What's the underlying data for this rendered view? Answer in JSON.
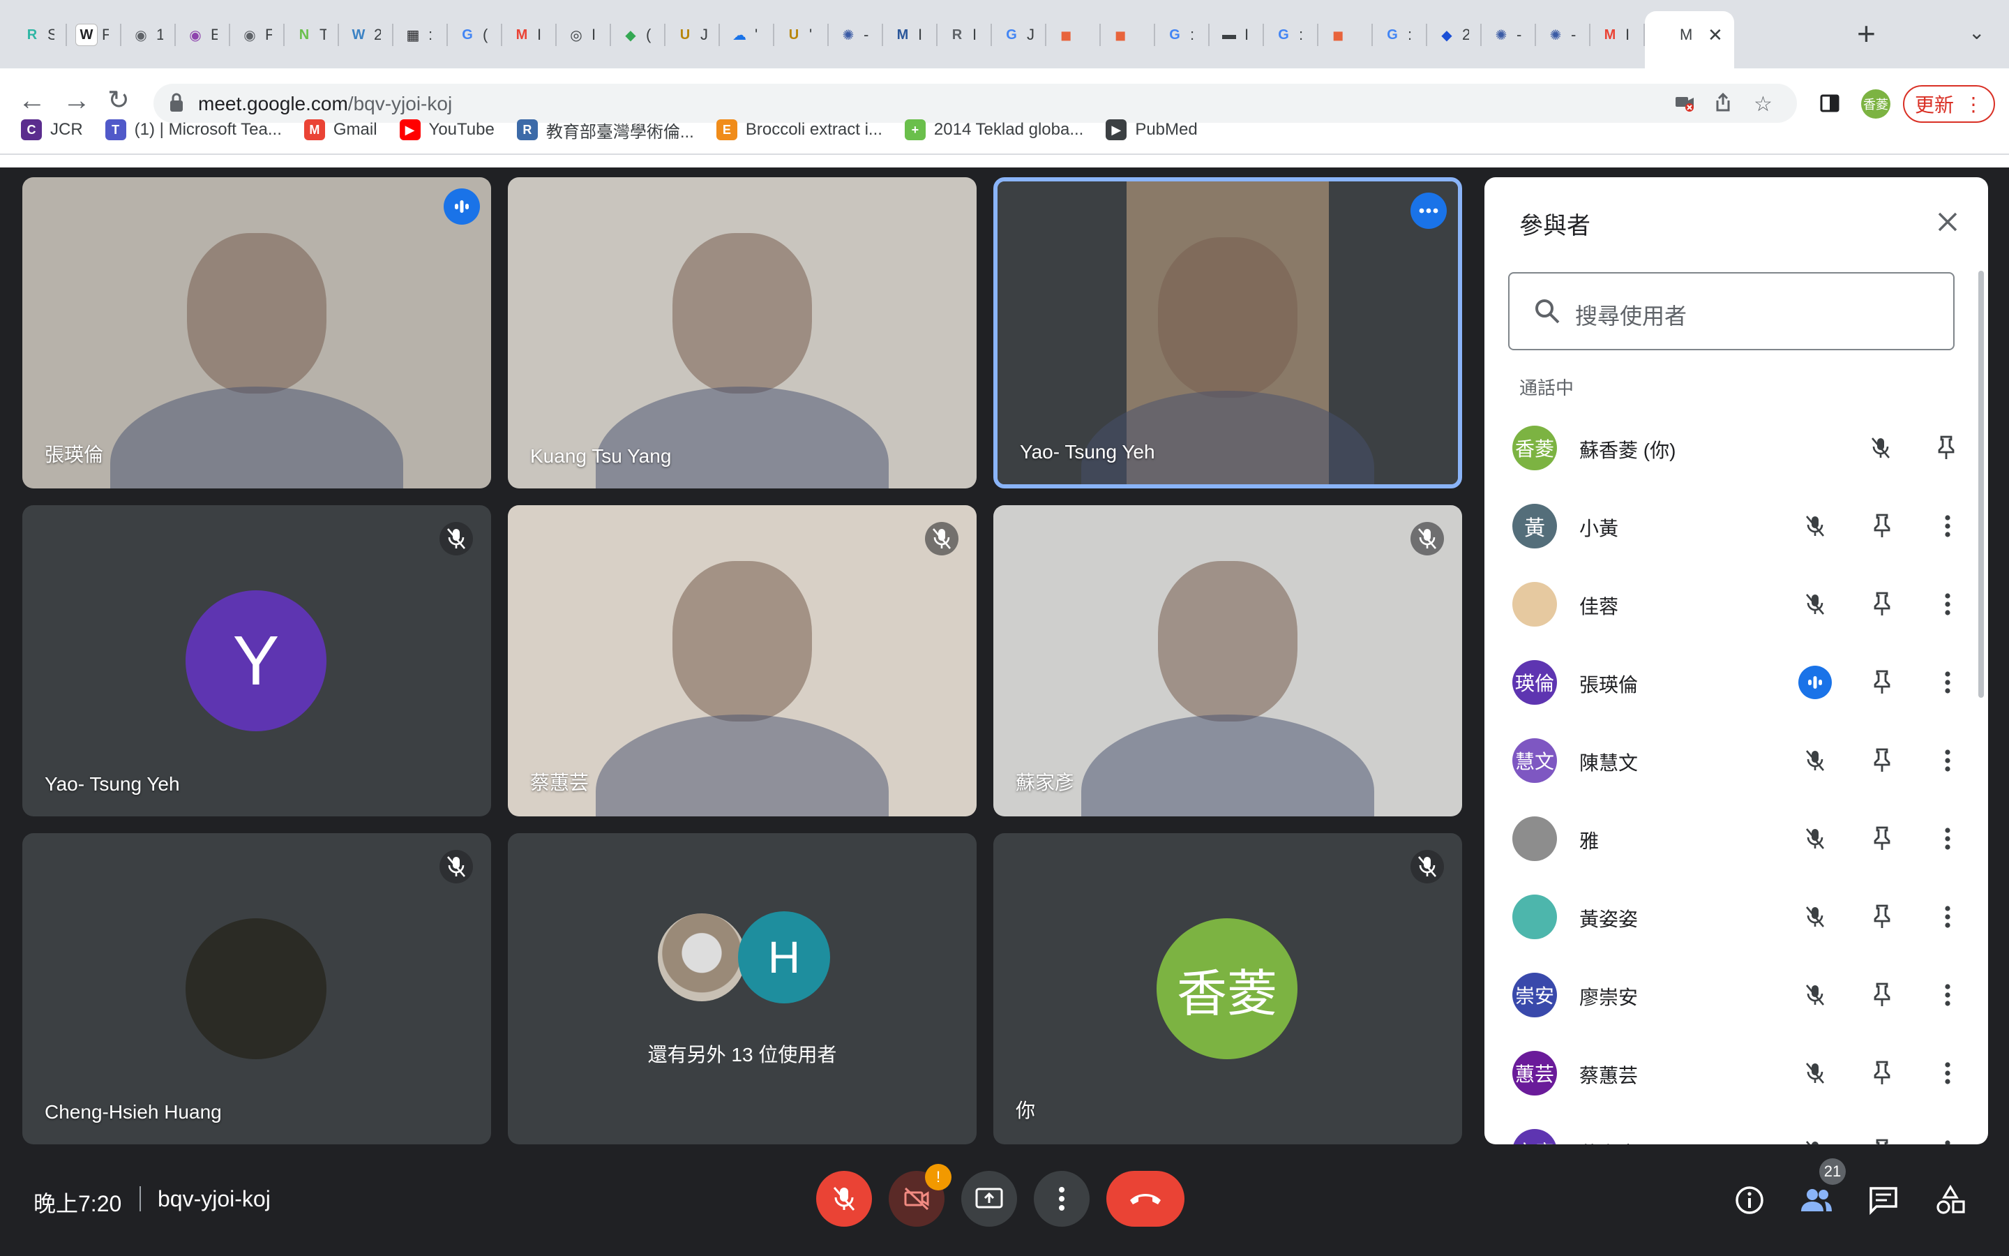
{
  "browser": {
    "url_host": "meet.google.com",
    "url_path": "/bqv-yjoi-koj",
    "update_label": "更新",
    "profile_label": "香菱",
    "tabs": [
      {
        "fav": "R",
        "color": "#2eb6a4",
        "t": "S"
      },
      {
        "fav": "W",
        "color": "#ffffff",
        "t": "F"
      },
      {
        "fav": "◉",
        "color": "#5f6368",
        "t": "1"
      },
      {
        "fav": "◉",
        "color": "#8e44ad",
        "t": "E"
      },
      {
        "fav": "◉",
        "color": "#5f6368",
        "t": "F"
      },
      {
        "fav": "N",
        "color": "#6abf4b",
        "t": "T"
      },
      {
        "fav": "W",
        "color": "#3b82c4",
        "t": "2"
      },
      {
        "fav": "▦",
        "color": "#202124",
        "t": ":"
      },
      {
        "fav": "G",
        "color": "#4285f4",
        "t": "("
      },
      {
        "fav": "M",
        "color": "#ea4335",
        "t": "I"
      },
      {
        "fav": "◎",
        "color": "#3c4043",
        "t": "I"
      },
      {
        "fav": "◆",
        "color": "#34a853",
        "t": "("
      },
      {
        "fav": "U",
        "color": "#b8860b",
        "t": "J"
      },
      {
        "fav": "☁",
        "color": "#1a73e8",
        "t": "'"
      },
      {
        "fav": "U",
        "color": "#b8860b",
        "t": "'"
      },
      {
        "fav": "✺",
        "color": "#3b5ba5",
        "t": "-"
      },
      {
        "fav": "M",
        "color": "#2b579a",
        "t": "I"
      },
      {
        "fav": "R",
        "color": "#5f6368",
        "t": "I"
      },
      {
        "fav": "G",
        "color": "#4285f4",
        "t": "J"
      },
      {
        "fav": "◼",
        "color": "#e8643c",
        "t": ""
      },
      {
        "fav": "◼",
        "color": "#e8643c",
        "t": ""
      },
      {
        "fav": "G",
        "color": "#4285f4",
        "t": ":"
      },
      {
        "fav": "▬",
        "color": "#3c4043",
        "t": "I"
      },
      {
        "fav": "G",
        "color": "#4285f4",
        "t": ":"
      },
      {
        "fav": "◼",
        "color": "#e8643c",
        "t": ""
      },
      {
        "fav": "G",
        "color": "#4285f4",
        "t": ":"
      },
      {
        "fav": "◆",
        "color": "#1a4fd6",
        "t": "2"
      },
      {
        "fav": "✺",
        "color": "#3b5ba5",
        "t": "-"
      },
      {
        "fav": "✺",
        "color": "#3b5ba5",
        "t": "-"
      },
      {
        "fav": "M",
        "color": "#ea4335",
        "t": "I"
      }
    ],
    "active_tab": {
      "t": "M"
    },
    "bookmarks": [
      {
        "label": "JCR",
        "color": "#5b2d8e",
        "icon": "C"
      },
      {
        "label": "(1) | Microsoft Tea...",
        "color": "#5059c9",
        "icon": "T"
      },
      {
        "label": "Gmail",
        "color": "#ea4335",
        "icon": "M"
      },
      {
        "label": "YouTube",
        "color": "#ff0000",
        "icon": "▶"
      },
      {
        "label": "教育部臺灣學術倫...",
        "color": "#3c6aa8",
        "icon": "R"
      },
      {
        "label": "Broccoli extract i...",
        "color": "#f08c1a",
        "icon": "E"
      },
      {
        "label": "2014 Teklad globa...",
        "color": "#6abf4b",
        "icon": "+"
      },
      {
        "label": "PubMed",
        "color": "#3c4043",
        "icon": "▶"
      }
    ]
  },
  "tiles": [
    {
      "name": "張瑛倫",
      "kind": "video",
      "bg": "#b7b2aa",
      "status": "speaking"
    },
    {
      "name": "Kuang Tsu Yang",
      "kind": "video",
      "bg": "#c9c5be",
      "status": "none"
    },
    {
      "name": "Yao- Tsung Yeh",
      "kind": "video",
      "bg": "#4a4a4a",
      "status": "more"
    },
    {
      "name": "Yao- Tsung Yeh",
      "kind": "avatar",
      "initial": "Y",
      "color": "#5e35b1",
      "status": "muted"
    },
    {
      "name": "蔡蕙芸",
      "kind": "video",
      "bg": "#d8d0c6",
      "status": "muted"
    },
    {
      "name": "蘇家彥",
      "kind": "video",
      "bg": "#cfcfcd",
      "status": "muted"
    },
    {
      "name": "Cheng-Hsieh Huang",
      "kind": "avatar",
      "initial": "",
      "color": "#2b2b25",
      "status": "muted"
    },
    {
      "name": "還有另外 13 位使用者",
      "kind": "others",
      "initial": "H",
      "color": "#1e8e9e",
      "status": "none"
    },
    {
      "name": "你",
      "kind": "avatar",
      "initial": "香菱",
      "color": "#7cb342",
      "status": "muted"
    }
  ],
  "panel": {
    "title": "參與者",
    "search_placeholder": "搜尋使用者",
    "section": "通話中",
    "people": [
      {
        "name": "蘇香菱 (你)",
        "avatar": "香菱",
        "color": "#7cb342",
        "state": "muted",
        "more": false
      },
      {
        "name": "小黃",
        "avatar": "黃",
        "color": "#546e7a",
        "state": "muted",
        "more": true
      },
      {
        "name": "佳蓉",
        "avatar": "",
        "color": "#e6c9a0",
        "state": "muted",
        "more": true
      },
      {
        "name": "張瑛倫",
        "avatar": "瑛倫",
        "color": "#5e35b1",
        "state": "speaking",
        "more": true
      },
      {
        "name": "陳慧文",
        "avatar": "慧文",
        "color": "#7e57c2",
        "state": "muted",
        "more": true
      },
      {
        "name": "雅",
        "avatar": "",
        "color": "#8d8d8d",
        "state": "muted",
        "more": true
      },
      {
        "name": "黃姿姿",
        "avatar": "",
        "color": "#4db6ac",
        "state": "muted",
        "more": true
      },
      {
        "name": "廖崇安",
        "avatar": "崇安",
        "color": "#3949ab",
        "state": "muted",
        "more": true
      },
      {
        "name": "蔡蕙芸",
        "avatar": "蕙芸",
        "color": "#6a1b9a",
        "state": "muted",
        "more": true
      },
      {
        "name": "蘇家彥",
        "avatar": "家彥",
        "color": "#5e35b1",
        "state": "muted",
        "more": true
      }
    ]
  },
  "bottom": {
    "time": "晚上7:20",
    "meeting_code": "bqv-yjoi-koj",
    "people_count": "21",
    "camera_alert": "!"
  },
  "colors": {
    "end_call": "#ea4335",
    "mic_off": "#ea4335",
    "camera_off": "#5a2a27",
    "accent": "#1a73e8"
  }
}
